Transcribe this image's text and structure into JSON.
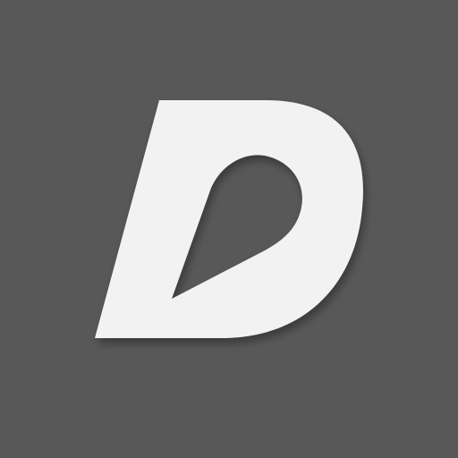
{
  "app_icon": {
    "icon": "stylized-letter-d-logo-icon",
    "letter": "D",
    "colors": {
      "background": "#585858",
      "glyph": "#f2f2f2",
      "shadow": "#000000"
    }
  }
}
